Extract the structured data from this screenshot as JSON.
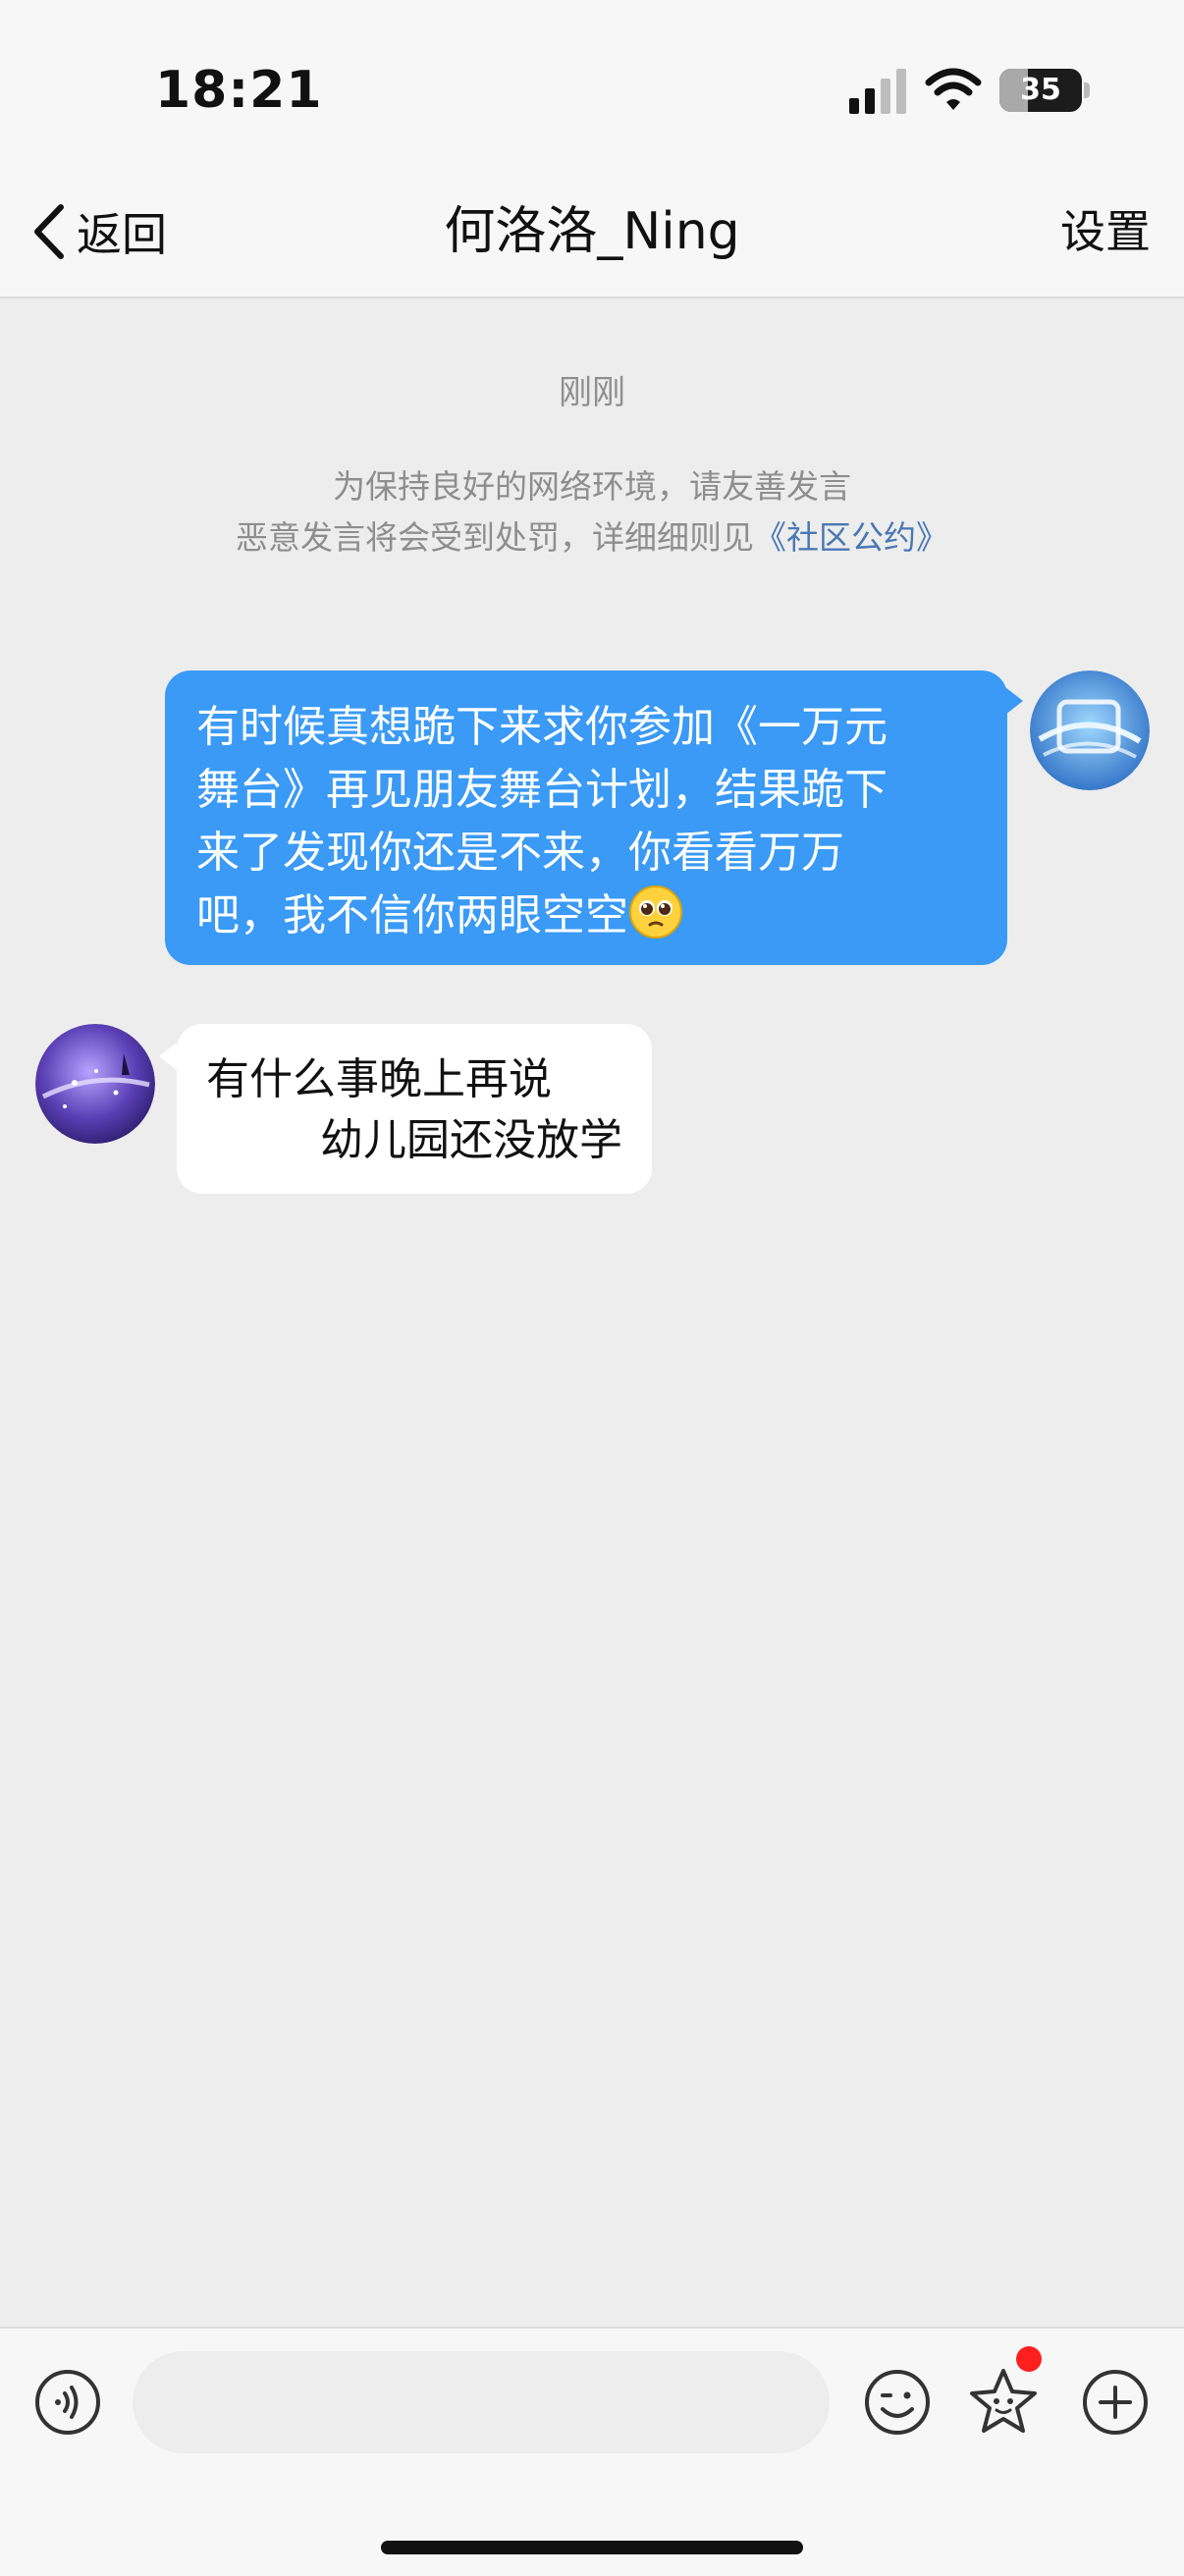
{
  "status_bar": {
    "time": "18:21",
    "battery": "35",
    "battery_level": 0.35
  },
  "nav": {
    "back_label": "返回",
    "title": "何洛洛_Ning",
    "settings_label": "设置"
  },
  "chat": {
    "timestamp": "刚刚",
    "notice_line1": "为保持良好的网络环境，请友善发言",
    "notice_line2": "恶意发言将会受到处罚，详细细则见",
    "notice_link": "《社区公约》",
    "messages": [
      {
        "direction": "outgoing",
        "lines": [
          "有时候真想跪下来求你参加《一万元",
          "舞台》再见朋友舞台计划，结果跪下",
          "来了发现你还是不来，你看看万万",
          "吧，我不信你两眼空空"
        ],
        "emoji": "pleading-face"
      },
      {
        "direction": "incoming",
        "lines": [
          "有什么事晚上再说",
          "幼儿园还没放学"
        ]
      }
    ]
  },
  "input": {
    "placeholder": ""
  },
  "colors": {
    "bubble_out": "#3a9af5",
    "bubble_in": "#ffffff",
    "background": "#ededed",
    "link": "#4a78b5",
    "badge": "#ff1f1f"
  }
}
